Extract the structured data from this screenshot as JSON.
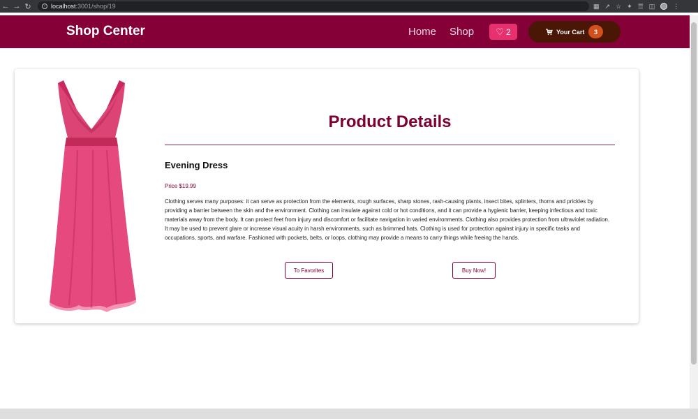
{
  "browser": {
    "url_host": "localhost",
    "url_path": ":3001/shop/19"
  },
  "header": {
    "brand": "Shop Center",
    "nav": {
      "home": "Home",
      "shop": "Shop"
    },
    "favorites_count": "2",
    "cart_label": "Your Cart",
    "cart_count": "3"
  },
  "product": {
    "section_title": "Product Details",
    "name": "Evening Dress",
    "price": "Price $19.99",
    "description": "Clothing serves many purposes: it can serve as protection from the elements, rough surfaces, sharp stones, rash-causing plants, insect bites, splinters, thorns and prickles by providing a barrier between the skin and the environment. Clothing can insulate against cold or hot conditions, and it can provide a hygienic barrier, keeping infectious and toxic materials away from the body. It can protect feet from injury and discomfort or facilitate navigation in varied environments. Clothing also provides protection from ultraviolet radiation. It may be used to prevent glare or increase visual acuity in harsh environments, such as brimmed hats. Clothing is used for protection against injury in specific tasks and occupations, sports, and warfare. Fashioned with pockets, belts, or loops, clothing may provide a means to carry things while freeing the hands.",
    "favorites_button": "To Favorites",
    "buy_button": "Buy Now!"
  },
  "colors": {
    "header_bg": "#850037",
    "accent": "#850037",
    "favorites_bg": "#e8306e",
    "cart_bg": "#4a1706",
    "cart_badge": "#d2501b",
    "dress": "#e5497e"
  },
  "icons": {
    "favorites": "heart-icon",
    "cart": "cart-icon",
    "info": "info-icon"
  }
}
